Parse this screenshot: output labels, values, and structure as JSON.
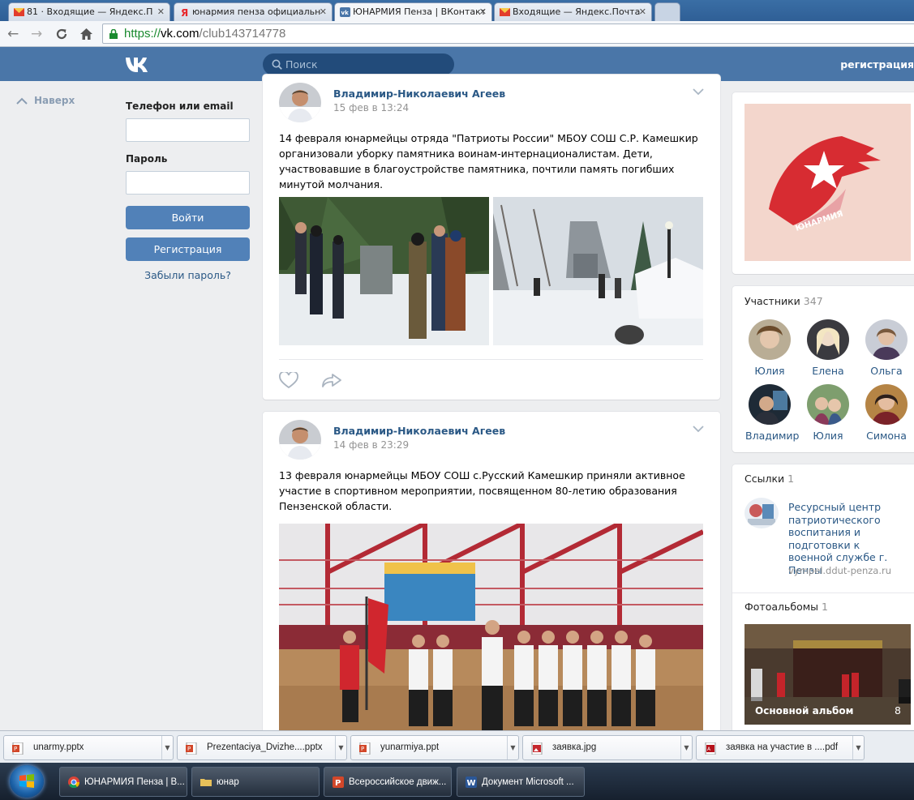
{
  "browser": {
    "tabs": [
      {
        "title": "81 · Входящие — Яндекс.П",
        "icon": "mail-envelope-icon"
      },
      {
        "title": "юнармия пенза официальн",
        "icon": "yandex-icon"
      },
      {
        "title": "ЮНАРМИЯ Пенза | ВКонтакте",
        "icon": "vk-icon",
        "active": true
      },
      {
        "title": "Входящие — Яндекс.Почта",
        "icon": "mail-envelope-icon"
      }
    ],
    "url": {
      "scheme": "https://",
      "host": "vk.com",
      "path": "/club143714778"
    }
  },
  "vk_header": {
    "logo": "VK",
    "search_placeholder": "Поиск",
    "register": "регистрация"
  },
  "left": {
    "back_to_top": "Наверх",
    "login": {
      "phone_label": "Телефон или email",
      "password_label": "Пароль",
      "login_button": "Войти",
      "register_button": "Регистрация",
      "forgot": "Забыли пароль?"
    }
  },
  "posts": [
    {
      "author": "Владимир-Николаевич Агеев",
      "date": "15 фев в 13:24",
      "text": "14 февраля юнармейцы отряда \"Патриоты России\" МБОУ СОШ С.Р. Камешкир организовали уборку памятника воинам-интернационалистам. Дети, участвовавшие в благоустройстве памятника, почтили память погибших минутой молчания."
    },
    {
      "author": "Владимир-Николаевич Агеев",
      "date": "14 фев в 23:29",
      "text": "13 февраля юнармейцы МБОУ СОШ с.Русский Камешкир приняли активное участие в спортивном мероприятии, посвященном 80-летию образования Пензенской области."
    }
  ],
  "right": {
    "cover_logo_text": "ЮНАРМИЯ",
    "members": {
      "title": "Участники",
      "count": "347",
      "people": [
        "Юлия",
        "Елена",
        "Ольга",
        "Владимир",
        "Юлия",
        "Симона"
      ]
    },
    "links": {
      "title": "Ссылки",
      "count": "1",
      "item_title": "Ресурсный центр патриотического воспитания и подготовки к военной службе г. Пензы",
      "item_url": "vympel.ddut-penza.ru"
    },
    "albums": {
      "title": "Фотоальбомы",
      "count": "1",
      "album_name": "Основной альбом",
      "album_count": "8"
    }
  },
  "downloads": [
    {
      "name": "unarmy.pptx",
      "icon": "powerpoint-file-icon"
    },
    {
      "name": "Prezentaciya_Dvizhe....pptx",
      "icon": "powerpoint-file-icon"
    },
    {
      "name": "yunarmiya.ppt",
      "icon": "powerpoint-file-icon"
    },
    {
      "name": "заявка.jpg",
      "icon": "image-file-icon"
    },
    {
      "name": "заявка на участие в ....pdf",
      "icon": "pdf-file-icon"
    }
  ],
  "taskbar": [
    {
      "label": "ЮНАРМИЯ Пенза | В...",
      "icon": "chrome-icon"
    },
    {
      "label": "юнар",
      "icon": "folder-icon"
    },
    {
      "label": "Всероссийское движ...",
      "icon": "powerpoint-icon"
    },
    {
      "label": "Документ Microsoft ...",
      "icon": "word-icon"
    }
  ],
  "colors": {
    "vk_blue": "#4a76a8",
    "link_blue": "#2a5885",
    "button_blue": "#5181b8",
    "page_bg": "#edeef0"
  }
}
